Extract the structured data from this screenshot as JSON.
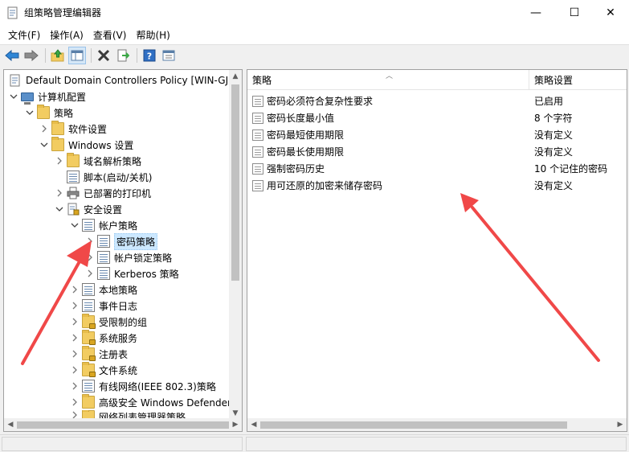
{
  "window": {
    "title": "组策略管理编辑器",
    "minimize": "—",
    "maximize": "☐",
    "close": "✕"
  },
  "menu": [
    {
      "label": "文件(F)"
    },
    {
      "label": "操作(A)"
    },
    {
      "label": "查看(V)"
    },
    {
      "label": "帮助(H)"
    }
  ],
  "toolbar": [
    "back-icon",
    "forward-icon",
    "up-folder-icon",
    "show-tree-icon",
    "delete-icon",
    "export-icon",
    "help-icon",
    "properties-icon"
  ],
  "tree": [
    {
      "label": "Default Domain Controllers Policy [WIN-GJL",
      "icon": "policy"
    },
    {
      "label": "计算机配置",
      "icon": "computer"
    },
    {
      "label": "策略",
      "icon": "folder"
    },
    {
      "label": "软件设置",
      "icon": "folder"
    },
    {
      "label": "Windows 设置",
      "icon": "folder"
    },
    {
      "label": "域名解析策略",
      "icon": "folder"
    },
    {
      "label": "脚本(启动/关机)",
      "icon": "doc"
    },
    {
      "label": "已部署的打印机",
      "icon": "printer"
    },
    {
      "label": "安全设置",
      "icon": "security"
    },
    {
      "label": "帐户策略",
      "icon": "doc"
    },
    {
      "label": "密码策略",
      "icon": "doc",
      "selected": true
    },
    {
      "label": "帐户锁定策略",
      "icon": "doc"
    },
    {
      "label": "Kerberos 策略",
      "icon": "doc"
    },
    {
      "label": "本地策略",
      "icon": "doc"
    },
    {
      "label": "事件日志",
      "icon": "doc"
    },
    {
      "label": "受限制的组",
      "icon": "folder-lock"
    },
    {
      "label": "系统服务",
      "icon": "folder-lock"
    },
    {
      "label": "注册表",
      "icon": "folder-lock"
    },
    {
      "label": "文件系统",
      "icon": "folder-lock"
    },
    {
      "label": "有线网络(IEEE 802.3)策略",
      "icon": "doc"
    },
    {
      "label": "高级安全 Windows Defender",
      "icon": "folder"
    },
    {
      "label": "网络列表管理器策略",
      "icon": "folder"
    }
  ],
  "list": {
    "columns": {
      "policy": "策略",
      "setting": "策略设置"
    },
    "rows": [
      {
        "policy": "密码必须符合复杂性要求",
        "setting": "已启用"
      },
      {
        "policy": "密码长度最小值",
        "setting": "8 个字符"
      },
      {
        "policy": "密码最短使用期限",
        "setting": "没有定义"
      },
      {
        "policy": "密码最长使用期限",
        "setting": "没有定义"
      },
      {
        "policy": "强制密码历史",
        "setting": "10 个记住的密码"
      },
      {
        "policy": "用可还原的加密来储存密码",
        "setting": "没有定义"
      }
    ]
  },
  "colors": {
    "annotation_arrow": "#f04848",
    "selection": "#cce8ff"
  }
}
